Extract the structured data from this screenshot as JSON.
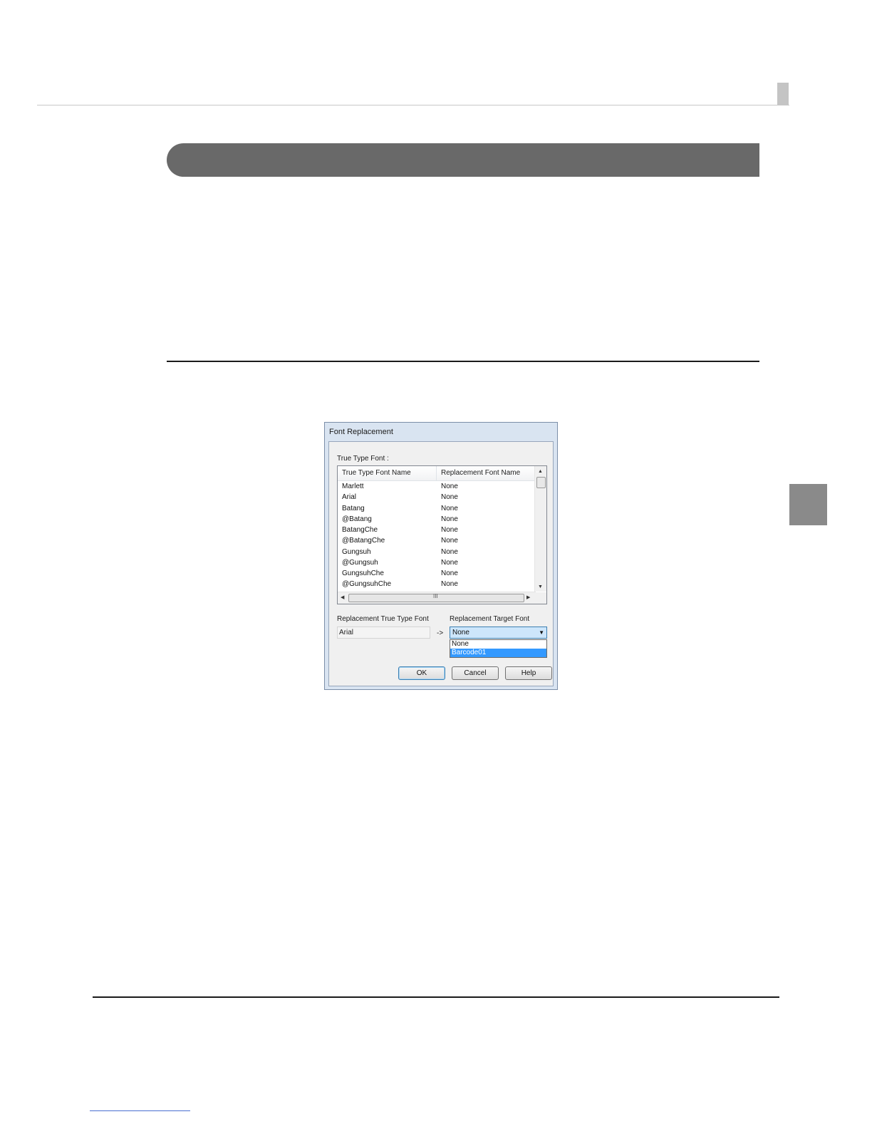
{
  "dialog": {
    "title": "Font Replacement",
    "group_label": "True Type Font :",
    "columns": [
      "True Type Font Name",
      "Replacement Font Name"
    ],
    "rows": [
      [
        "Marlett",
        "None"
      ],
      [
        "Arial",
        "None"
      ],
      [
        "Batang",
        "None"
      ],
      [
        "@Batang",
        "None"
      ],
      [
        "BatangChe",
        "None"
      ],
      [
        "@BatangChe",
        "None"
      ],
      [
        "Gungsuh",
        "None"
      ],
      [
        "@Gungsuh",
        "None"
      ],
      [
        "GungsuhChe",
        "None"
      ],
      [
        "@GungsuhChe",
        "None"
      ]
    ],
    "hscroll_grip": "III",
    "replacement_ttf_label": "Replacement True Type Font",
    "replacement_ttf_value": "Arial",
    "arrow_label": "->",
    "target_font_label": "Replacement Target Font",
    "target_font_value": "None",
    "target_font_options": [
      "None",
      "Barcode01"
    ],
    "selected_option_index": 1,
    "buttons": {
      "ok": "OK",
      "cancel": "Cancel",
      "help": "Help"
    }
  },
  "colors": {
    "section_banner": "#696969",
    "selection_highlight": "#3399ff",
    "dialog_frame": "#d9e4f1"
  }
}
